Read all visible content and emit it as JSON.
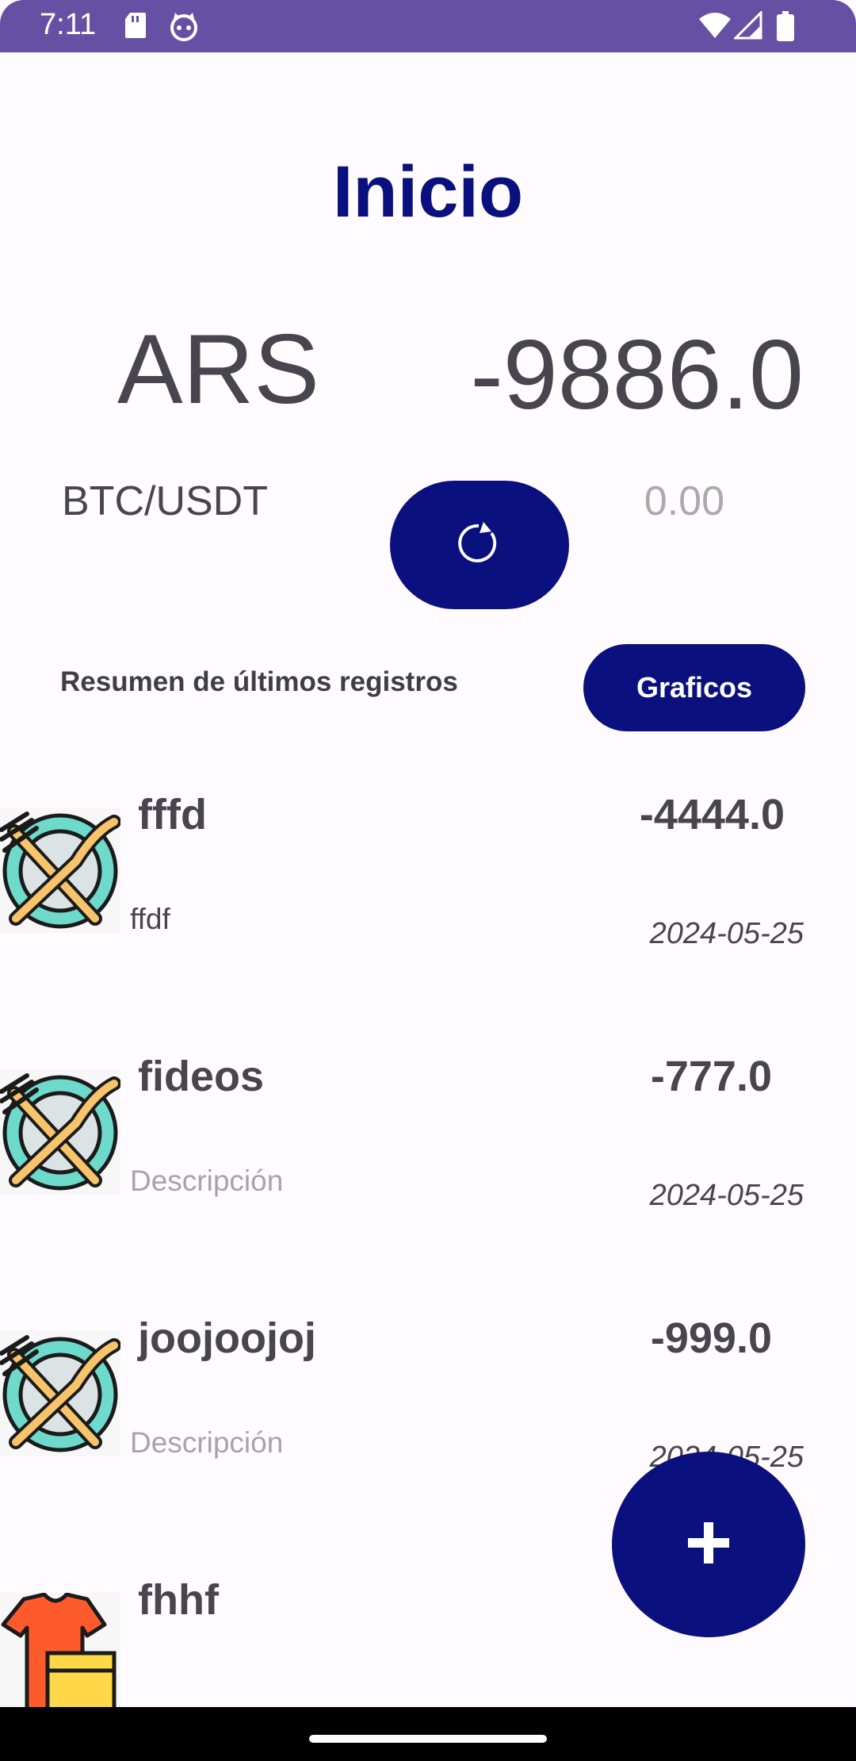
{
  "status_bar": {
    "time": "7:11",
    "left_icons": [
      "sd-card-icon",
      "cat-app-icon"
    ],
    "right_icons": [
      "wifi-icon",
      "signal-icon",
      "battery-icon"
    ],
    "background": "#6650A4"
  },
  "header": {
    "title": "Inicio"
  },
  "balance": {
    "currency": "ARS",
    "amount": "-9886.0"
  },
  "crypto": {
    "pair_label": "BTC/USDT",
    "value": "0.00",
    "refresh_icon": "refresh-icon"
  },
  "summary": {
    "label": "Resumen de últimos registros",
    "charts_button": "Graficos"
  },
  "records": [
    {
      "title": "fffd",
      "amount": "-4444.0",
      "description": "ffdf",
      "description_is_placeholder": false,
      "date": "2024-05-25",
      "icon": "food-icon"
    },
    {
      "title": "fideos",
      "amount": "-777.0",
      "description": "Descripción",
      "description_is_placeholder": true,
      "date": "2024-05-25",
      "icon": "food-icon"
    },
    {
      "title": "joojoojoj",
      "amount": "-999.0",
      "description": "Descripción",
      "description_is_placeholder": true,
      "date": "2024-05-25",
      "icon": "food-icon"
    },
    {
      "title": "fhhf",
      "amount": "",
      "description": "",
      "description_is_placeholder": false,
      "date": "",
      "icon": "clothes-icon"
    }
  ],
  "fab": {
    "label": "+"
  },
  "colors": {
    "accent": "#0A107D",
    "text": "#49454F",
    "placeholder": "#A6A3AB",
    "background": "#FFFBFE"
  }
}
